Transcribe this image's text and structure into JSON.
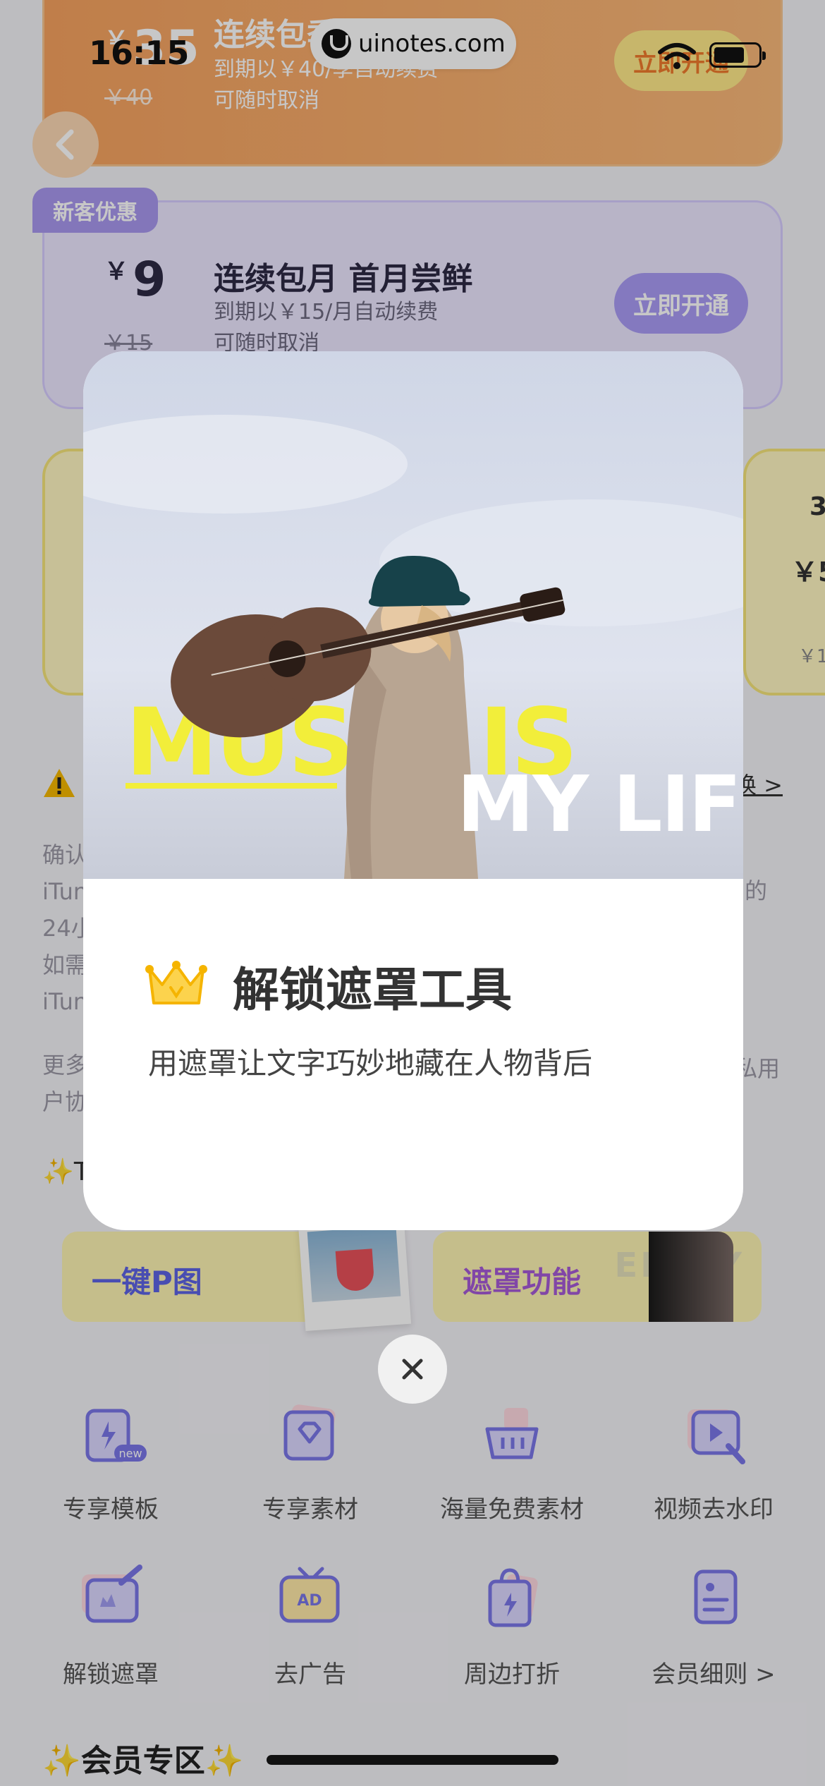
{
  "status_bar": {
    "time": "16:15",
    "watermark": "uinotes.com"
  },
  "plans": {
    "orange": {
      "currency": "￥",
      "price": "35",
      "old_price": "￥40",
      "title": "连续包季",
      "sub1": "到期以￥40/季自动续费",
      "sub2": "可随时取消",
      "button": "立即开通"
    },
    "purple": {
      "badge": "新客优惠",
      "currency": "￥",
      "price": "9",
      "old_price": "￥15",
      "title": "连续包月 首月尝鲜",
      "sub1": "到期以￥15/月自动续费",
      "sub2": "可随时取消",
      "button": "立即开通"
    },
    "right_card": {
      "t1": "3",
      "t2": "￥5",
      "t3": "￥1"
    }
  },
  "notice": {
    "link": "换 >",
    "legal_1_lines": [
      "确认",
      "iTun",
      "24小",
      "如需",
      "iTun"
    ],
    "legal_1_right": "的",
    "legal_2_lines": [
      "更多",
      "户协"
    ],
    "legal_2_right": "私用"
  },
  "promos": {
    "section_title": "✨T",
    "items": [
      {
        "label": "一键P图",
        "ghost": ""
      },
      {
        "label": "遮罩功能",
        "ghost": "ENJOY"
      }
    ]
  },
  "features": [
    {
      "label": "专享模板",
      "icon": "template-icon",
      "badge": "new"
    },
    {
      "label": "专享素材",
      "icon": "diamond-folder-icon"
    },
    {
      "label": "海量免费素材",
      "icon": "basket-icon"
    },
    {
      "label": "视频去水印",
      "icon": "video-watermark-icon"
    },
    {
      "label": "解锁遮罩",
      "icon": "mask-edit-icon"
    },
    {
      "label": "去广告",
      "icon": "ad-tv-icon"
    },
    {
      "label": "周边打折",
      "icon": "shopping-bag-icon"
    },
    {
      "label": "会员细则 >",
      "icon": "document-icon"
    }
  ],
  "section_title": "✨会员专区✨",
  "modal": {
    "hero_text_1": "MUSIC IS",
    "hero_text_2": "MY LIFE",
    "title": "解锁遮罩工具",
    "description": "用遮罩让文字巧妙地藏在人物背后",
    "icon": "crown-icon"
  },
  "colors": {
    "accent_purple": "#a99cf5",
    "accent_orange": "#f7a25f",
    "promo_yellow": "#fdf4b2",
    "hero_yellow": "#f2ee3a"
  }
}
